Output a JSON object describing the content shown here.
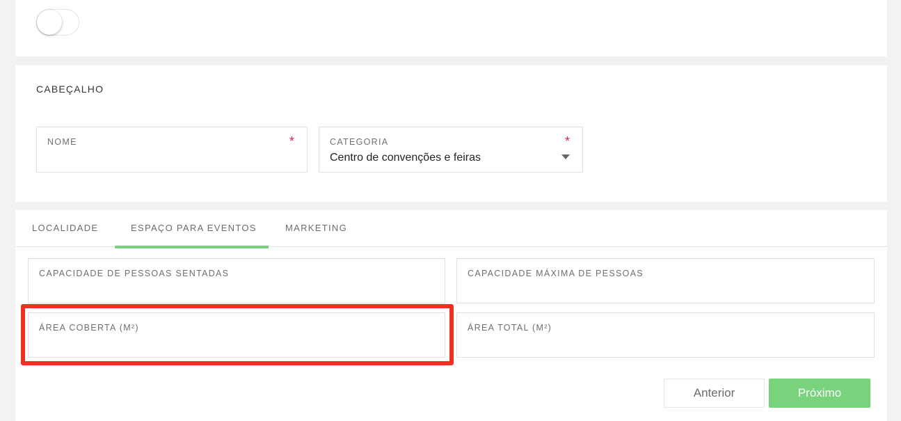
{
  "header": {
    "title": "CABEÇALHO",
    "nome_label": "NOME",
    "nome_value": "",
    "categoria_label": "CATEGORIA",
    "categoria_value": "Centro de convenções e feiras",
    "required_mark": "*"
  },
  "toggle": {
    "checked": false
  },
  "tabs": [
    {
      "label": "LOCALIDADE",
      "active": false
    },
    {
      "label": "ESPAÇO PARA EVENTOS",
      "active": true
    },
    {
      "label": "MARKETING",
      "active": false
    }
  ],
  "fields": {
    "capacidade_sentadas": "CAPACIDADE DE PESSOAS SENTADAS",
    "capacidade_maxima": "CAPACIDADE MÁXIMA DE PESSOAS",
    "area_coberta": "ÁREA COBERTA (M²)",
    "area_total": "ÁREA TOTAL (M²)"
  },
  "buttons": {
    "previous": "Anterior",
    "next": "Próximo"
  },
  "colors": {
    "accent": "#78d37c",
    "highlight": "#f2301f",
    "required": "#d9224f"
  }
}
